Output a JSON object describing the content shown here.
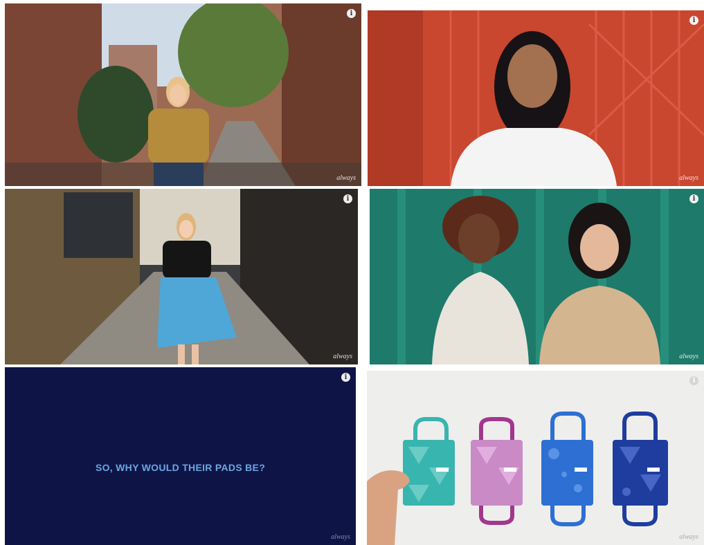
{
  "panels": [
    {
      "id": "panel-1",
      "brand": "always",
      "info": "i"
    },
    {
      "id": "panel-2",
      "brand": "always",
      "info": "i"
    },
    {
      "id": "panel-3",
      "brand": "always",
      "info": "i"
    },
    {
      "id": "panel-4",
      "brand": "always",
      "info": "i"
    },
    {
      "id": "panel-5",
      "brand": "always",
      "info": "i",
      "caption": "SO, WHY WOULD THEIR PADS BE?"
    },
    {
      "id": "panel-6",
      "brand": "always",
      "info": "i"
    }
  ],
  "colors": {
    "navy_background": "#0f1446",
    "caption_blue": "#6aa7e3",
    "teal_pad": "#39b5b0",
    "purple_pad": "#a2378f",
    "blue_pad": "#2d6fd3",
    "navy_pad": "#1f3d9e"
  },
  "icons": [
    "info-icon"
  ]
}
